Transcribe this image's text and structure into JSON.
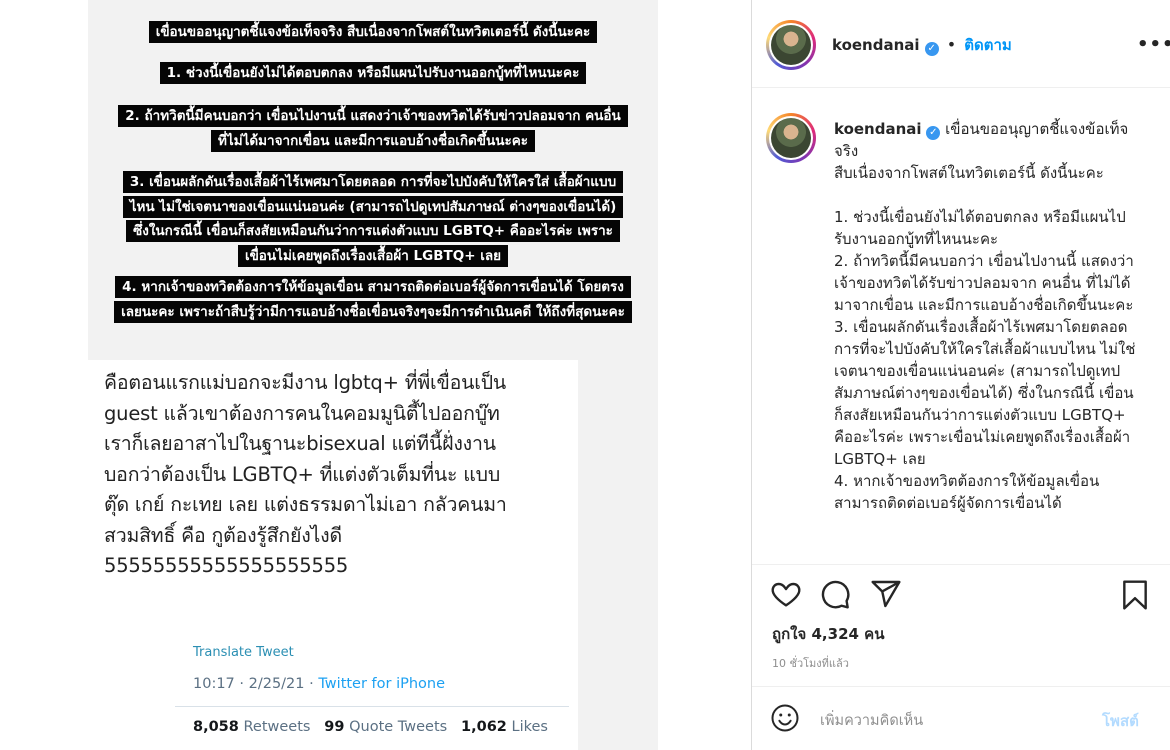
{
  "story": {
    "captions": [
      "เขื่อนขออนุญาตชี้แจงข้อเท็จจริง สืบเนื่องจากโพสต์ในทวิตเตอร์นี้ ดังนี้นะคะ",
      "1. ช่วงนี้เขื่อนยังไม่ได้ตอบตกลง หรือมีแผนไปรับงานออกบู้ทที่ไหนนะคะ",
      "2. ถ้าทวิตนี้มีคนบอกว่า เขื่อนไปงานนี้ แสดงว่าเจ้าของทวิตได้รับข่าวปลอมจาก คนอื่น ที่ไม่ได้มาจากเขื่อน และมีการแอบอ้างชื่อเกิดขึ้นนะคะ",
      "3. เขื่อนผลักดันเรื่องเสื้อผ้าไร้เพศมาโดยตลอด การที่จะไปบังคับให้ใครใส่ เสื้อผ้าแบบไหน ไม่ใช่เจตนาของเขื่อนแน่นอนค่ะ (สามารถไปดูเทปสัมภาษณ์ ต่างๆของเขื่อนได้) ซึ่งในกรณีนี้ เขื่อนก็สงสัยเหมือนกันว่าการแต่งตัวแบบ LGBTQ+ คืออะไรค่ะ เพราะเขื่อนไม่เคยพูดถึงเรื่องเสื้อผ้า LGBTQ+ เลย",
      "4. หากเจ้าของทวิตต้องการให้ข้อมูลเขื่อน สามารถติดต่อเบอร์ผู้จัดการเขื่อนได้ โดยตรงเลยนะคะ เพราะถ้าสืบรู้ว่ามีการแอบอ้างชื่อเขื่อนจริงๆจะมีการดำเนินคดี ให้ถึงที่สุดนะคะ"
    ],
    "tweet": {
      "text": "คือตอนแรกแม่บอกจะมีงาน lgbtq+ ที่พี่เขื่อนเป็น guest แล้วเขาต้องการคนในคอมมูนิตี้ไปออกบู๊ท เราก็เลยอาสาไปในฐานะbisexual แต่ทีนี้ฝั่งงานบอกว่าต้องเป็น LGBTQ+ ที่แต่งตัวเต็มที่นะ แบบตุ๊ด เกย์ กะเทย เลย แต่งธรรมดาไม่เอา กลัวคนมาสวมสิทธิ์ คือ กูต้องรู้สึกยังไงดี 55555555555555555555",
      "translate_label": "Translate Tweet",
      "time": "10:17 · 2/25/21 · ",
      "via": "Twitter for iPhone",
      "retweets": "8,058",
      "retweets_label": "Retweets",
      "quotes": "99",
      "quotes_label": "Quote Tweets",
      "likes": "1,062",
      "likes_label": "Likes"
    }
  },
  "post": {
    "username": "koendanai",
    "follow_label": "ติดตาม",
    "separator": "•",
    "caption_lines": [
      "เขื่อนขออนุญาตชี้แจงข้อเท็จจริง",
      "สืบเนื่องจากโพสต์ในทวิตเตอร์นี้ ดังนี้นะคะ",
      "",
      "1. ช่วงนี้เขื่อนยังไม่ได้ตอบตกลง หรือมีแผนไปรับงานออกบู้ทที่ไหนนะคะ",
      "2. ถ้าทวิตนี้มีคนบอกว่า เขื่อนไปงานนี้ แสดงว่าเจ้าของทวิตได้รับข่าวปลอมจาก คนอื่น ที่ไม่ได้มาจากเขื่อน และมีการแอบอ้างชื่อเกิดขึ้นนะคะ",
      "3. เขื่อนผลักดันเรื่องเสื้อผ้าไร้เพศมาโดยตลอด การที่จะไปบังคับให้ใครใส่เสื้อผ้าแบบไหน ไม่ใช่เจตนาของเขื่อนแน่นอนค่ะ (สามารถไปดูเทปสัมภาษณ์ต่างๆของเขื่อนได้) ซึ่งในกรณีนี้ เขื่อนก็สงสัยเหมือนกันว่าการแต่งตัวแบบ LGBTQ+ คืออะไรค่ะ เพราะเขื่อนไม่เคยพูดถึงเรื่องเสื้อผ้า LGBTQ+ เลย",
      "4. หากเจ้าของทวิตต้องการให้ข้อมูลเขื่อน สามารถติดต่อเบอร์ผู้จัดการเขื่อนได้"
    ],
    "likes_text": "ถูกใจ 4,324 คน",
    "time_ago": "10 ชั่วโมงที่แล้ว",
    "comment_placeholder": "เพิ่มความคิดเห็น",
    "post_button": "โพสต์",
    "more_label": "•••",
    "verified_glyph": "✓"
  },
  "icons": [
    "verified-badge-icon",
    "more-options-icon",
    "heart-icon",
    "comment-icon",
    "share-icon",
    "bookmark-icon",
    "emoji-icon"
  ],
  "colors": {
    "follow": "#0095f6",
    "verified": "#3897f0",
    "post_disabled": "#b3dbff",
    "twitter_blue": "#1da1f2"
  }
}
